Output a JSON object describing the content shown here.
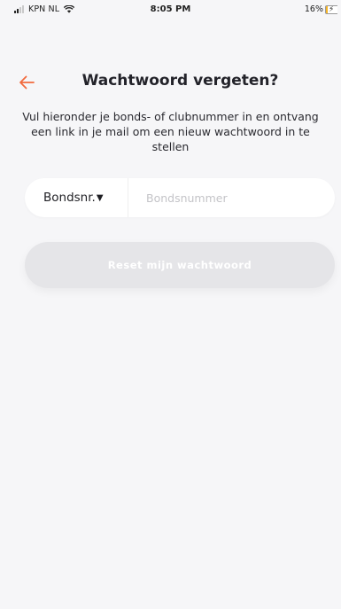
{
  "status_bar": {
    "carrier": "KPN NL",
    "time": "8:05 PM",
    "battery_percent_label": "16%",
    "battery_level": 0.16,
    "signal_bars_filled": 2,
    "signal_bars_total": 4
  },
  "header": {
    "back_icon": "arrow-left-icon",
    "title": "Wachtwoord vergeten?"
  },
  "description": "Vul hieronder je bonds- of clubnummer in en ontvang een link in je mail om een nieuw wachtwoord in te stellen",
  "form": {
    "type_select_label": "Bondsnr.",
    "type_select_caret": "▼",
    "number_input_value": "",
    "number_input_placeholder": "Bondsnummer",
    "reset_button_label": "Reset mijn wachtwoord"
  },
  "colors": {
    "accent": "#f26a3d",
    "background": "#f6f6f8",
    "button_disabled": "#e5e5e8"
  }
}
